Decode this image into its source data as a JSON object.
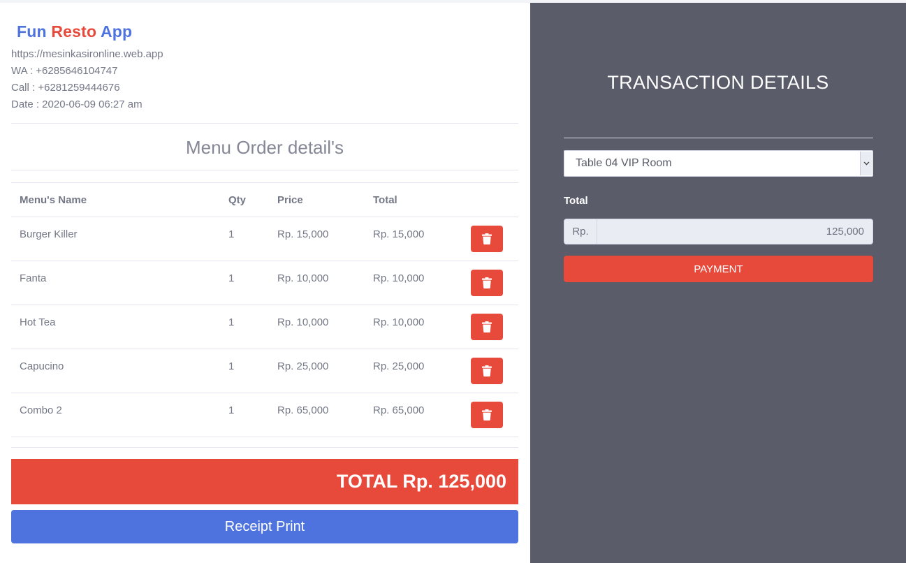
{
  "brand": {
    "word1": "Fun",
    "word2": "Resto",
    "word3": "App"
  },
  "store_info": {
    "url": "https://mesinkasironline.web.app",
    "wa": "WA : +6285646104747",
    "call": "Call : +6281259444676",
    "date": "Date : 2020-06-09 06:27 am"
  },
  "order": {
    "title": "Menu Order detail's",
    "columns": {
      "name": "Menu's Name",
      "qty": "Qty",
      "price": "Price",
      "total": "Total"
    },
    "items": [
      {
        "name": "Burger Killer",
        "qty": "1",
        "price": "Rp. 15,000",
        "total": "Rp. 15,000"
      },
      {
        "name": "Fanta",
        "qty": "1",
        "price": "Rp. 10,000",
        "total": "Rp. 10,000"
      },
      {
        "name": "Hot Tea",
        "qty": "1",
        "price": "Rp. 10,000",
        "total": "Rp. 10,000"
      },
      {
        "name": "Capucino",
        "qty": "1",
        "price": "Rp. 25,000",
        "total": "Rp. 25,000"
      },
      {
        "name": "Combo 2",
        "qty": "1",
        "price": "Rp. 65,000",
        "total": "Rp. 65,000"
      }
    ],
    "delete_icon": "trash-icon",
    "grand_total": "TOTAL Rp. 125,000",
    "receipt_button": "Receipt Print"
  },
  "transaction": {
    "title": "TRANSACTION DETAILS",
    "table_select": "Table 04 VIP Room",
    "total_label": "Total",
    "currency_prefix": "Rp.",
    "total_amount": "125,000",
    "payment_button": "PAYMENT"
  },
  "colors": {
    "primary": "#4e73df",
    "danger": "#e74a3b",
    "sidebar": "#5a5c69"
  }
}
